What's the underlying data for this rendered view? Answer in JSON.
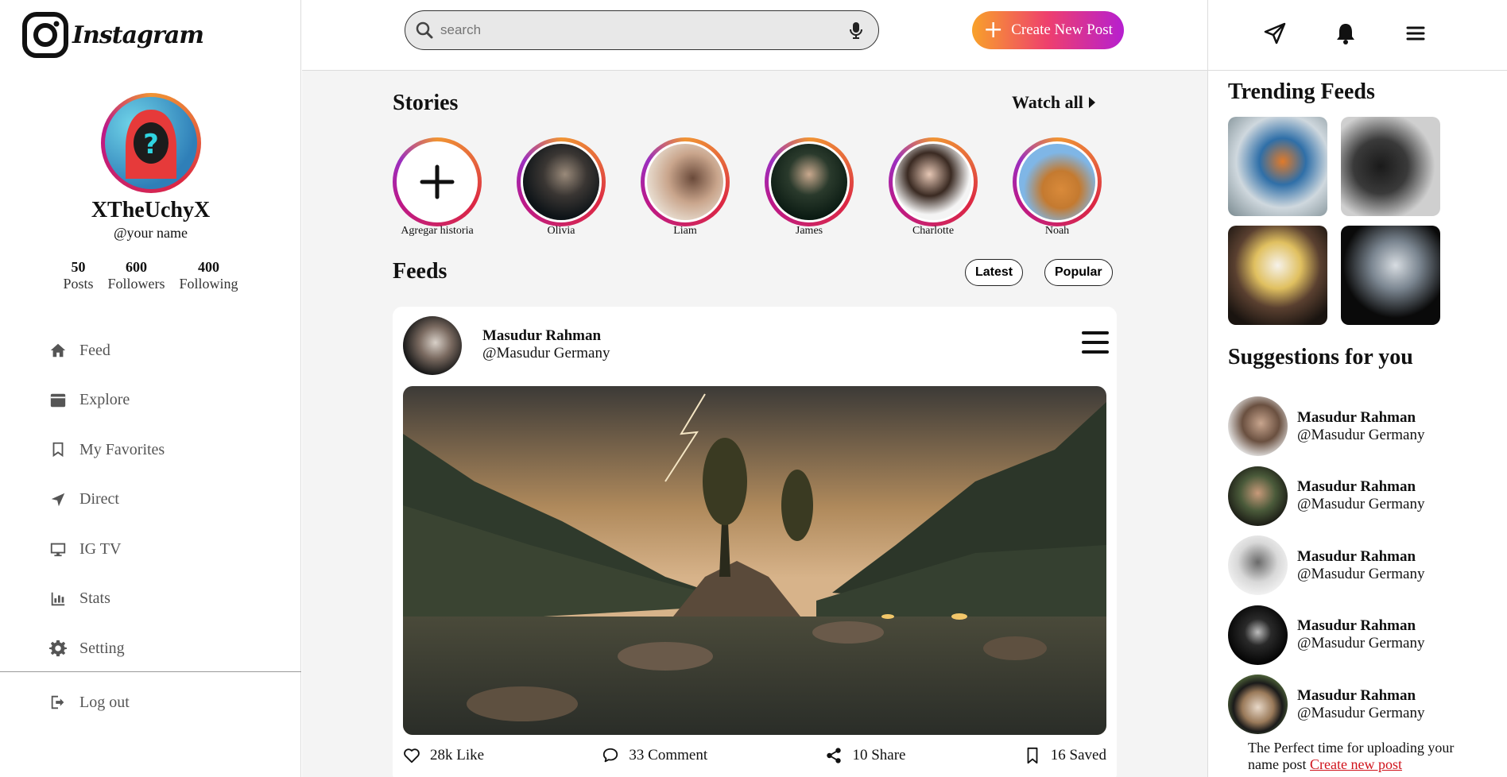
{
  "brand": {
    "wordmark": "Instagram"
  },
  "profile": {
    "name": "XTheUchyX",
    "handle": "@your name"
  },
  "stats": [
    {
      "value": "50",
      "label": "Posts"
    },
    {
      "value": "600",
      "label": "Followers"
    },
    {
      "value": "400",
      "label": "Following"
    }
  ],
  "nav": [
    {
      "label": "Feed",
      "icon": "home-icon"
    },
    {
      "label": "Explore",
      "icon": "compass-icon"
    },
    {
      "label": "My Favorites",
      "icon": "bookmark-icon"
    },
    {
      "label": "Direct",
      "icon": "send-icon"
    },
    {
      "label": "IG TV",
      "icon": "tv-icon"
    },
    {
      "label": "Stats",
      "icon": "chart-icon"
    },
    {
      "label": "Setting",
      "icon": "gear-icon"
    }
  ],
  "logout": {
    "label": "Log out",
    "icon": "logout-icon"
  },
  "search": {
    "placeholder": "search"
  },
  "create_post": {
    "label": "Create New Post"
  },
  "stories": {
    "title": "Stories",
    "watch_all": "Watch all",
    "items": [
      {
        "label": "Agregar historia"
      },
      {
        "label": "Olivia"
      },
      {
        "label": "Liam"
      },
      {
        "label": "James"
      },
      {
        "label": "Charlotte"
      },
      {
        "label": "Noah"
      }
    ]
  },
  "feeds": {
    "title": "Feeds",
    "filters": [
      "Latest",
      "Popular"
    ]
  },
  "post": {
    "author_name": "Masudur Rahman",
    "author_handle": "@Masudur Germany",
    "likes": "28k Like",
    "comments": "33 Comment",
    "shares": "10 Share",
    "saved": "16 Saved"
  },
  "trending": {
    "title": "Trending Feeds"
  },
  "suggestions": {
    "title": "Suggestions for you",
    "items": [
      {
        "name": "Masudur Rahman",
        "handle": "@Masudur Germany"
      },
      {
        "name": "Masudur Rahman",
        "handle": "@Masudur Germany"
      },
      {
        "name": "Masudur Rahman",
        "handle": "@Masudur Germany"
      },
      {
        "name": "Masudur Rahman",
        "handle": "@Masudur Germany"
      },
      {
        "name": "Masudur Rahman",
        "handle": "@Masudur Germany"
      }
    ]
  },
  "upload_note": {
    "text": "The Perfect time for uploading your name post",
    "link": "Create new post"
  },
  "colors": {
    "accent_start": "#f8a12a",
    "accent_mid": "#ee3f6e",
    "accent_end": "#b61fd0",
    "link": "#d0121b"
  }
}
